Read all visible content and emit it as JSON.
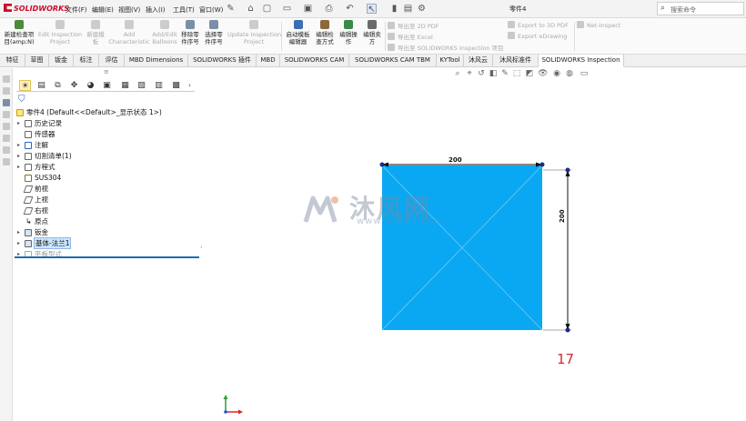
{
  "app": {
    "logo_text": "SOLIDWORKS",
    "doc_title": "零件4"
  },
  "menu": [
    "文件(F)",
    "编辑(E)",
    "视图(V)",
    "插入(I)",
    "工具(T)",
    "窗口(W)"
  ],
  "search": {
    "placeholder": "搜索命令"
  },
  "ribbon": {
    "buttons": [
      {
        "label": "新建检查项\n目(amp;N)",
        "enabled": true
      },
      {
        "label": "Edit Inspection\nProject",
        "enabled": false
      },
      {
        "label": "新建模\n板",
        "enabled": false
      },
      {
        "label": "Add\nCharacteristic",
        "enabled": false
      },
      {
        "label": "Add/Edit\nBalloons",
        "enabled": false
      },
      {
        "label": "移除零\n件序号",
        "enabled": true
      },
      {
        "label": "选择零\n件序号",
        "enabled": true
      },
      {
        "label": "Update Inspection\nProject",
        "enabled": false
      },
      {
        "label": "启动模板\n编辑器",
        "enabled": true
      },
      {
        "label": "编辑检\n查方式",
        "enabled": true
      },
      {
        "label": "编辑操\n作",
        "enabled": true
      },
      {
        "label": "编辑卖\n方",
        "enabled": true
      }
    ],
    "export_items": [
      "导出至 2D PDF",
      "导出至 Excel",
      "导出至 SOLIDWORKS Inspection 项目",
      "Export to 3D PDF",
      "Export eDrawing",
      "Net-Inspect"
    ]
  },
  "tabs": [
    "特征",
    "草图",
    "钣金",
    "标注",
    "评估",
    "MBD Dimensions",
    "SOLIDWORKS 插件",
    "MBD",
    "SOLIDWORKS CAM",
    "SOLIDWORKS CAM TBM",
    "KYTool",
    "沐风云",
    "沐风标准件",
    "SOLIDWORKS Inspection"
  ],
  "active_tab": "SOLIDWORKS Inspection",
  "tree": {
    "root": "零件4  (Default<<Default>_显示状态 1>)",
    "items": [
      {
        "label": "历史记录",
        "expandable": true
      },
      {
        "label": "传感器",
        "expandable": false
      },
      {
        "label": "注解",
        "expandable": true
      },
      {
        "label": "切割清单(1)",
        "expandable": true
      },
      {
        "label": "方程式",
        "expandable": true
      },
      {
        "label": "SUS304",
        "expandable": false
      },
      {
        "label": "前视",
        "expandable": false
      },
      {
        "label": "上视",
        "expandable": false
      },
      {
        "label": "右视",
        "expandable": false
      },
      {
        "label": "原点",
        "expandable": false
      },
      {
        "label": "钣金",
        "expandable": true
      },
      {
        "label": "基体-法兰1",
        "expandable": true,
        "selected": true
      },
      {
        "label": "平板型式",
        "expandable": true,
        "faded": true
      }
    ]
  },
  "drawing": {
    "dim_horizontal": "200",
    "dim_vertical": "200",
    "fill_color": "#0aa8f2",
    "marker": "17"
  },
  "watermark": {
    "name": "沐风网",
    "url": "www.mfcad.com"
  },
  "colors": {
    "accent": "#1a6fb0",
    "marker": "#d62d2d",
    "selection": "#cde6ff"
  }
}
